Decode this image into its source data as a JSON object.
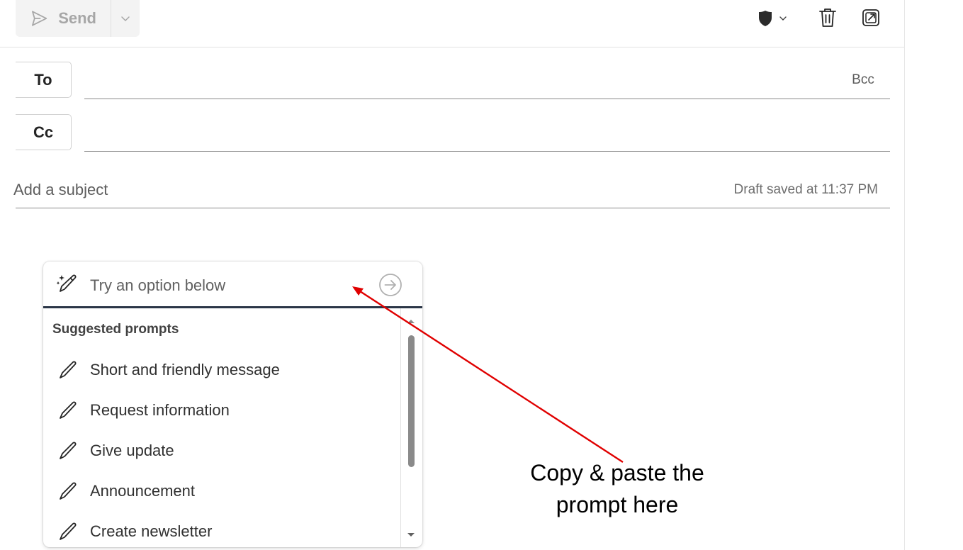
{
  "toolbar": {
    "send_label": "Send",
    "send_icon": "send-icon",
    "send_dropdown_icon": "chevron-down-icon",
    "sensitivity_icon": "shield-icon",
    "delete_icon": "trash-icon",
    "popout_icon": "popout-icon",
    "disabled_color": "#a6a6a6"
  },
  "recipients": {
    "to_label": "To",
    "cc_label": "Cc",
    "bcc_label": "Bcc",
    "to_value": "",
    "cc_value": ""
  },
  "subject": {
    "placeholder": "Add a subject",
    "display_text": "Add a subject",
    "value": "",
    "draft_status": "Draft saved at 11:37 PM"
  },
  "copilot": {
    "icon": "sparkle-pen-icon",
    "input_placeholder": "Try an option below",
    "input_value": "",
    "submit_icon": "arrow-right-circle-icon",
    "section_title": "Suggested prompts",
    "item_icon": "pencil-icon",
    "prompts": [
      {
        "label": "Short and friendly message"
      },
      {
        "label": "Request information"
      },
      {
        "label": "Give update"
      },
      {
        "label": "Announcement"
      },
      {
        "label": "Create newsletter"
      }
    ],
    "accent_color": "#2b3647"
  },
  "annotation": {
    "line1": "Copy & paste the",
    "line2": "prompt here",
    "arrow_color": "#e00000"
  }
}
